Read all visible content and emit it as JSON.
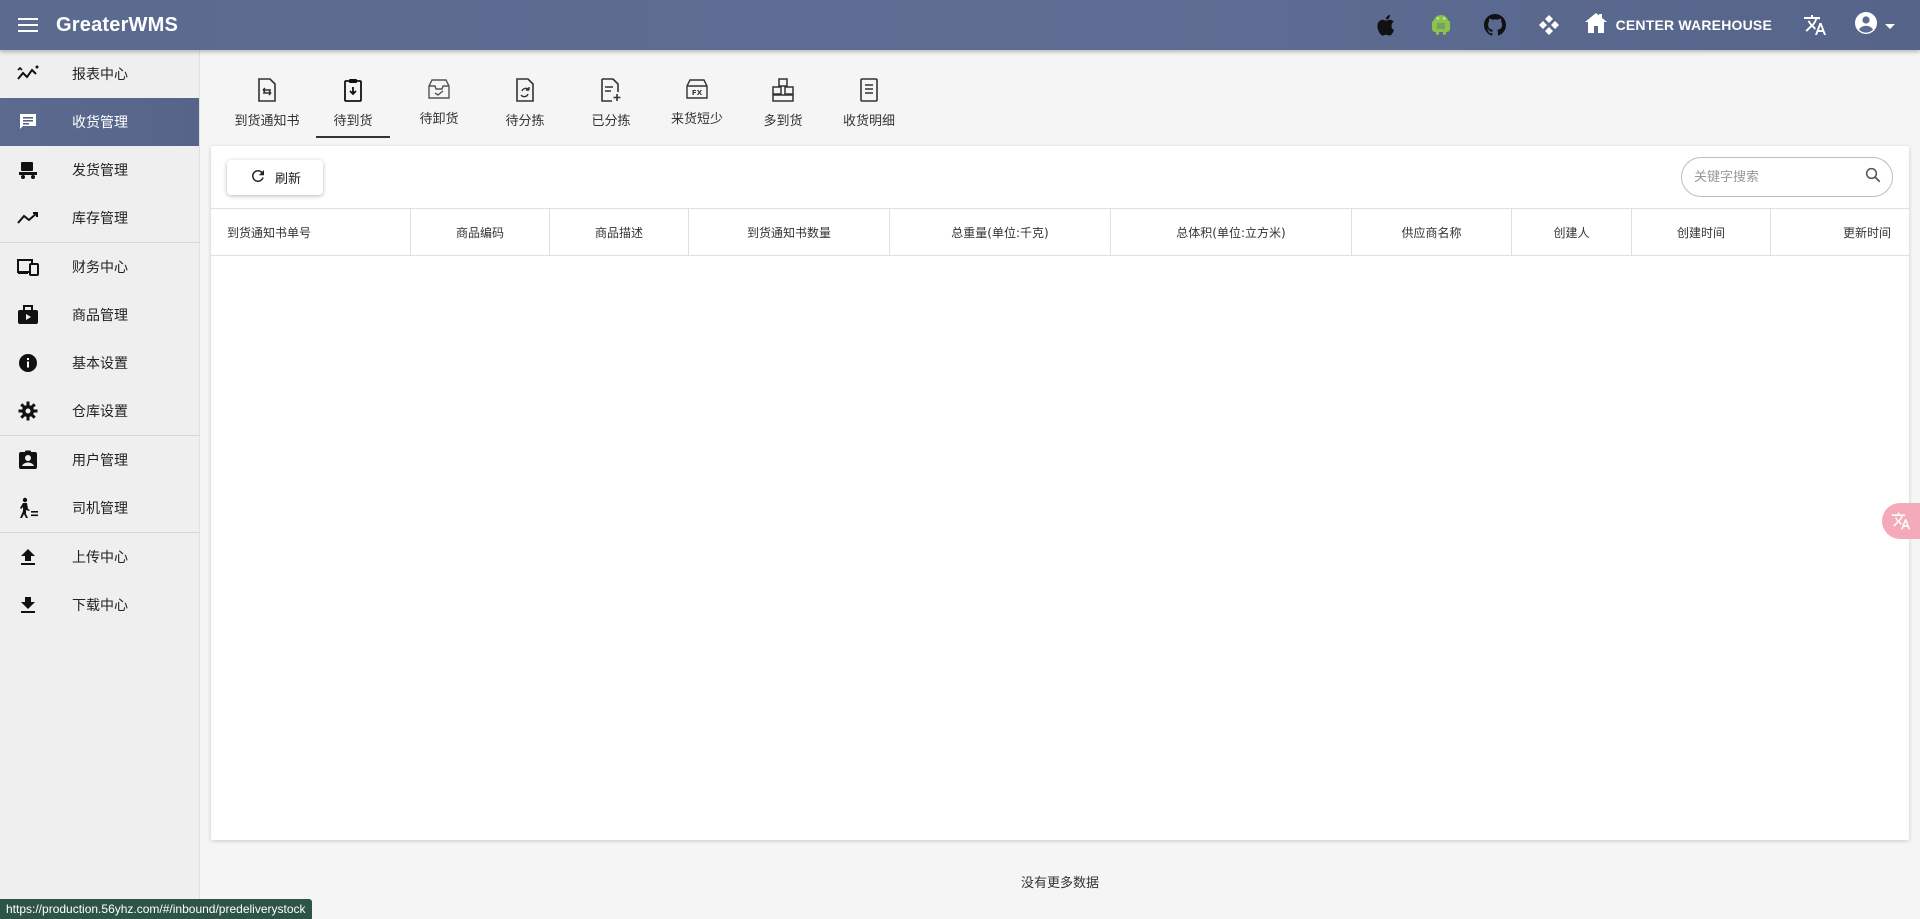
{
  "header": {
    "app_title": "GreaterWMS",
    "warehouse_label": "CENTER WAREHOUSE",
    "icons": [
      "menu-icon",
      "apple-icon",
      "android-icon",
      "github-icon",
      "api-icon",
      "warehouse-icon",
      "translate-icon",
      "account-icon",
      "caret-down-icon"
    ]
  },
  "sidebar": {
    "items": [
      {
        "label": "报表中心",
        "icon": "report-icon"
      },
      {
        "label": "收货管理",
        "icon": "receiving-icon",
        "active": true
      },
      {
        "label": "发货管理",
        "icon": "shipping-icon"
      },
      {
        "label": "库存管理",
        "icon": "stock-icon"
      },
      {
        "label": "财务中心",
        "icon": "finance-icon"
      },
      {
        "label": "商品管理",
        "icon": "goods-icon"
      },
      {
        "label": "基本设置",
        "icon": "info-icon"
      },
      {
        "label": "仓库设置",
        "icon": "gear-icon"
      },
      {
        "label": "用户管理",
        "icon": "user-badge-icon"
      },
      {
        "label": "司机管理",
        "icon": "driver-icon"
      },
      {
        "label": "上传中心",
        "icon": "upload-icon"
      },
      {
        "label": "下载中心",
        "icon": "download-icon"
      }
    ]
  },
  "tabs": [
    {
      "label": "到货通知书"
    },
    {
      "label": "待到货",
      "active": true
    },
    {
      "label": "待卸货"
    },
    {
      "label": "待分拣"
    },
    {
      "label": "已分拣"
    },
    {
      "label": "来货短少"
    },
    {
      "label": "多到货"
    },
    {
      "label": "收货明细"
    }
  ],
  "toolbar": {
    "refresh_label": "刷新",
    "search_placeholder": "关键字搜索"
  },
  "table": {
    "columns": [
      "到货通知书单号",
      "商品编码",
      "商品描述",
      "到货通知书数量",
      "总重量(单位:千克)",
      "总体积(单位:立方米)",
      "供应商名称",
      "创建人",
      "创建时间",
      "更新时间"
    ],
    "rows": []
  },
  "footer": {
    "no_more_data": "没有更多数据"
  },
  "statusbar": {
    "url": "https://production.56yhz.com/#/inbound/predeliverystock"
  },
  "colors": {
    "header_bg": "#5b6a8f",
    "sidebar_bg": "#efefef",
    "status_bg": "#2e5448",
    "android_green": "#8bc34a"
  }
}
